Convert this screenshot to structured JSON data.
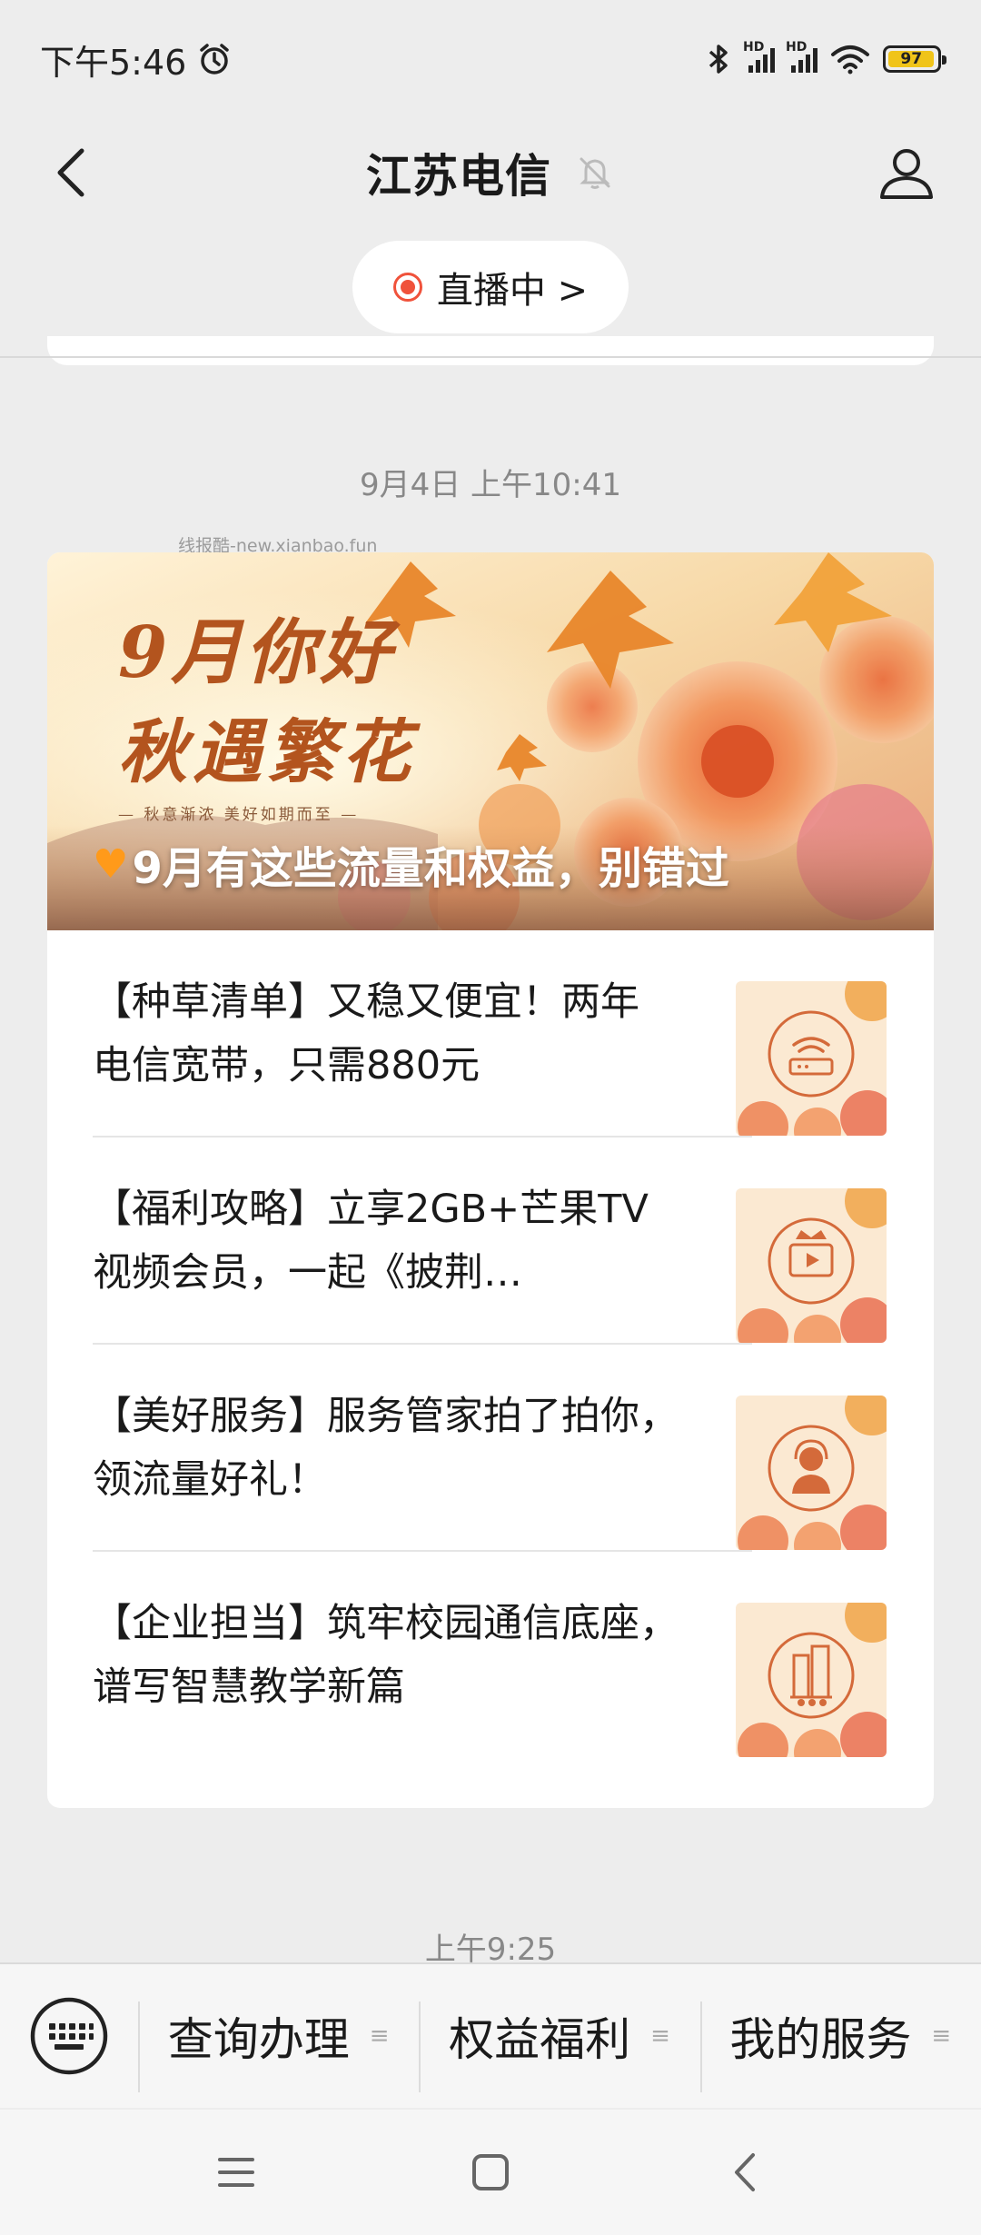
{
  "status_bar": {
    "time": "下午5:46",
    "battery": "97"
  },
  "header": {
    "title": "江苏电信"
  },
  "live": {
    "label": "直播中 >"
  },
  "messages": [
    {
      "timestamp": "9月4日 上午10:41",
      "watermark": "线报酷-new.xianbao.fun",
      "banner": {
        "line1": "9月你好",
        "line2": "秋遇繁花",
        "subtitle": "— 秋意渐浓 美好如期而至 —",
        "caption": "9月有这些流量和权益，别错过"
      },
      "articles": [
        {
          "title_line1": "【种草清单】又稳又便宜！两年",
          "title_line2": "电信宽带，只需880元",
          "icon": "wifi-router-icon"
        },
        {
          "title_line1": "【福利攻略】立享2GB+芒果TV",
          "title_line2": "视频会员，一起《披荆…",
          "icon": "video-crown-icon"
        },
        {
          "title_line1": "【美好服务】服务管家拍了拍你，",
          "title_line2": "领流量好礼！",
          "icon": "service-agent-icon"
        },
        {
          "title_line1": "【企业担当】筑牢校园通信底座，",
          "title_line2": "谱写智慧教学新篇",
          "icon": "building-icon"
        }
      ]
    },
    {
      "timestamp": "上午9:25"
    }
  ],
  "menu": {
    "items": [
      {
        "label": "查询办理"
      },
      {
        "label": "权益福利"
      },
      {
        "label": "我的服务"
      }
    ]
  },
  "colors": {
    "accent": "#f0523b",
    "background": "#ededed",
    "banner_text": "#b3541e",
    "heart": "#ff9a1a"
  }
}
